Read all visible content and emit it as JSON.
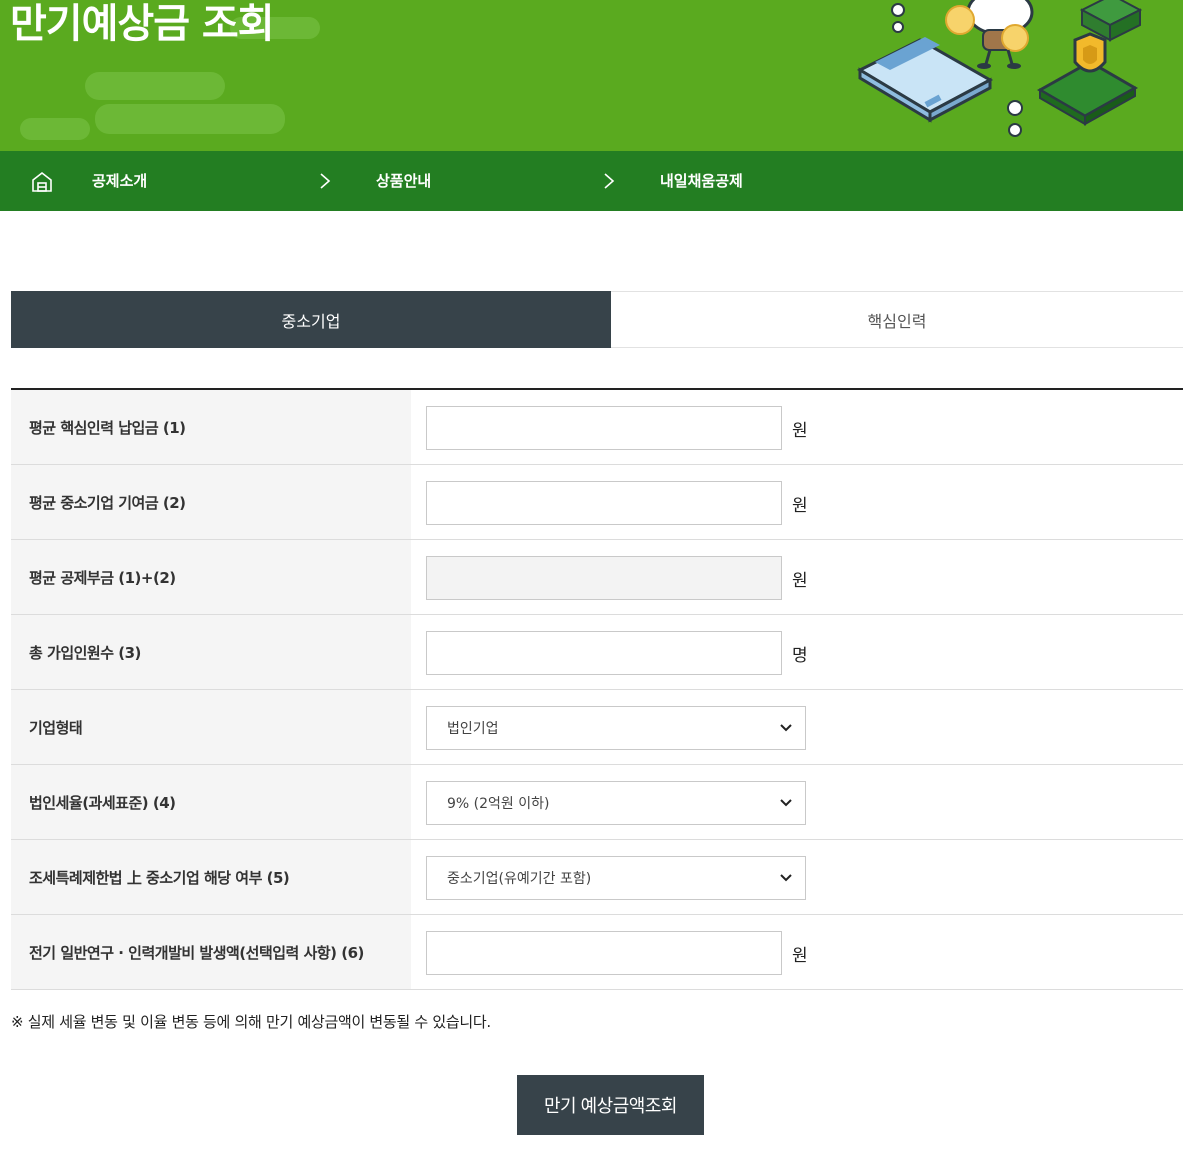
{
  "hero": {
    "title": "만기예상금 조회"
  },
  "breadcrumb": {
    "home_icon": "home-icon",
    "items": [
      {
        "label": "공제소개"
      },
      {
        "label": "상품안내"
      },
      {
        "label": "내일채움공제"
      }
    ],
    "separator_icon": "chevron-right-icon"
  },
  "tabs": [
    {
      "label": "중소기업",
      "active": true
    },
    {
      "label": "핵심인력",
      "active": false
    }
  ],
  "form": {
    "rows": [
      {
        "label": "평균 핵심인력 납입금 (1)",
        "value": "",
        "unit": "원"
      },
      {
        "label": "평균 중소기업 기여금 (2)",
        "value": "",
        "unit": "원"
      },
      {
        "label": "평균 공제부금 (1)+(2)",
        "value": "",
        "unit": "원",
        "readonly": true
      },
      {
        "label": "총 가입인원수 (3)",
        "value": "",
        "unit": "명"
      },
      {
        "label": "기업형태",
        "selected": "법인기업"
      },
      {
        "label": "법인세율(과세표준) (4)",
        "selected": "9% (2억원 이하)"
      },
      {
        "label": "조세특례제한법 上 중소기업 해당 여부 (5)",
        "selected": "중소기업(유예기간 포함)"
      },
      {
        "label": "전기 일반연구 · 인력개발비 발생액(선택입력 사항) (6)",
        "value": "",
        "unit": "원"
      }
    ]
  },
  "notice": "※ 실제 세율 변동 및 이율 변동 등에 의해 만기 예상금액이 변동될 수 있습니다.",
  "submit_label": "만기 예상금액조회",
  "colors": {
    "hero_green": "#5aaa1f",
    "breadcrumb_green": "#237e22",
    "active_tab": "#37434a",
    "button": "#37434a"
  }
}
